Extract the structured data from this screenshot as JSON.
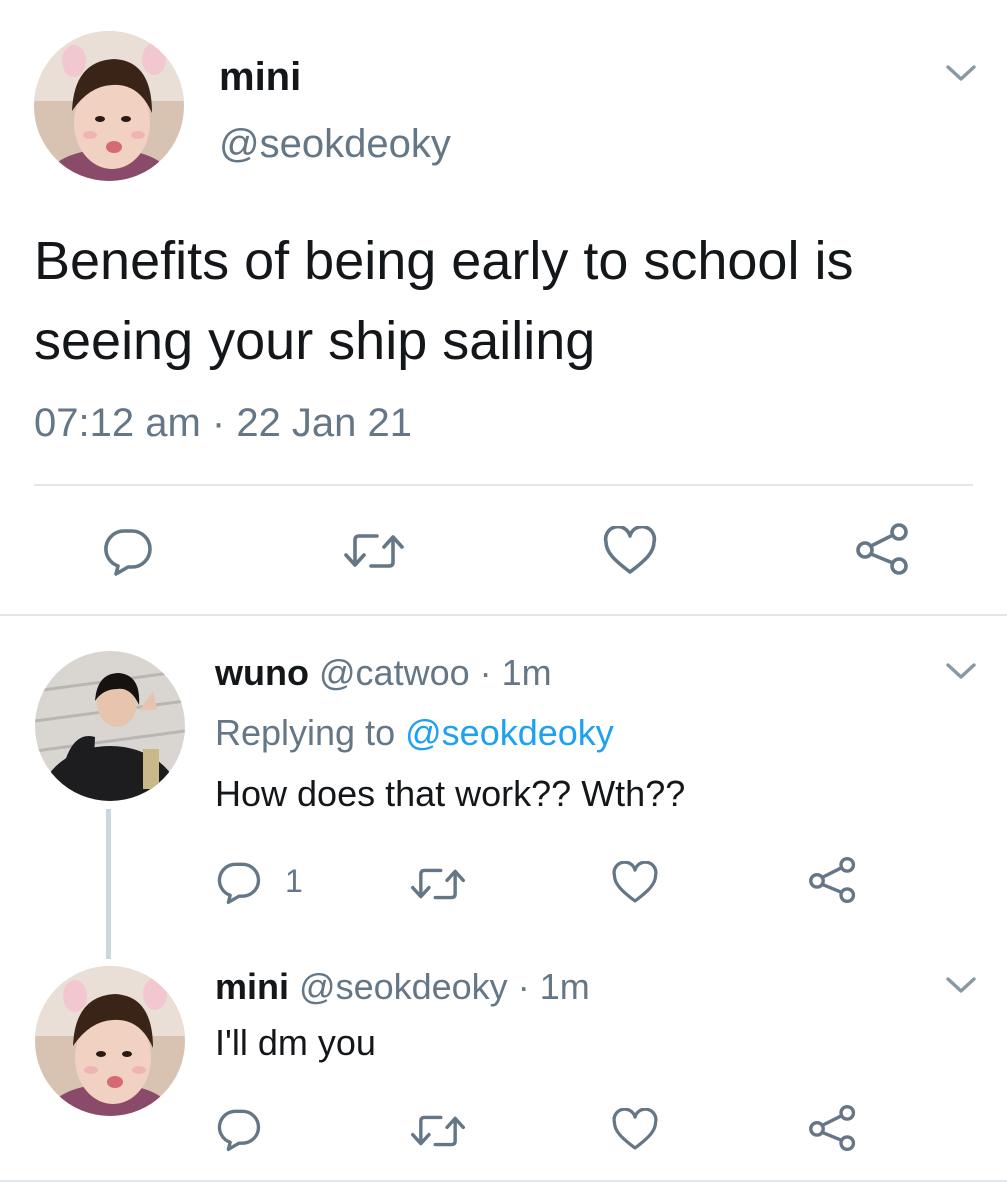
{
  "main_tweet": {
    "display_name": "mini",
    "handle": "@seokdeoky",
    "text_line1": "Benefits of being early to school is",
    "text_line2": "seeing your ship sailing",
    "timestamp": "07:12 am · 22 Jan 21",
    "avatar_icon": "user-photo-avatar"
  },
  "replies": [
    {
      "display_name": "wuno",
      "handle": "@catwoo",
      "sep": "·",
      "time": "1m",
      "replying_prefix": "Replying to",
      "replying_handle": "@seokdeoky",
      "text": "How does that work?? Wth??",
      "reply_count": "1"
    },
    {
      "display_name": "mini",
      "handle": "@seokdeoky",
      "sep": "·",
      "time": "1m",
      "text": "I'll dm you"
    }
  ],
  "colors": {
    "text": "#14171a",
    "secondary": "#657786",
    "link": "#1da1f2",
    "divider": "#e1e8ed"
  },
  "icons": [
    "reply-icon",
    "retweet-icon",
    "like-icon",
    "share-icon",
    "chevron-down-icon"
  ]
}
